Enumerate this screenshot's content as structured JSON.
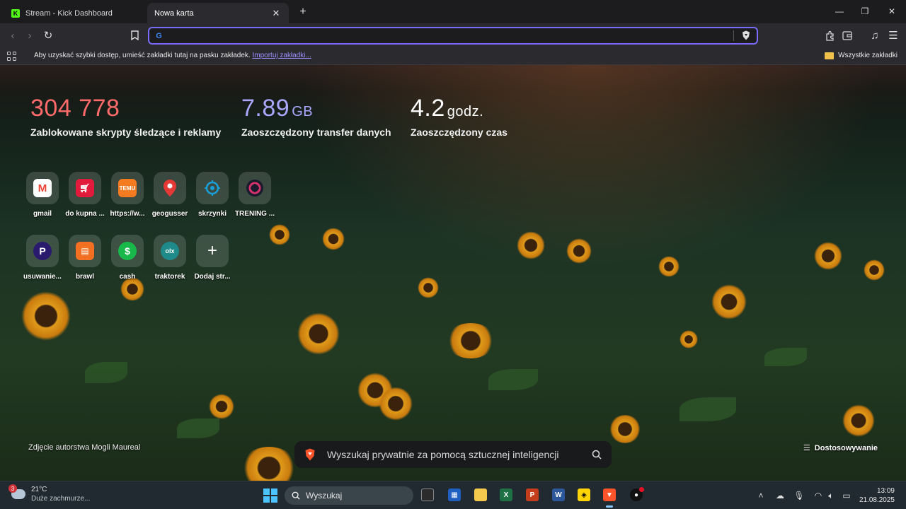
{
  "tabs": [
    {
      "title": "Stream - Kick Dashboard",
      "icon": "kick-icon",
      "active": false
    },
    {
      "title": "Nowa karta",
      "active": true
    }
  ],
  "address_bar": {
    "value": "",
    "search_engine_icon": "google-icon"
  },
  "bookmarks_bar": {
    "message": "Aby uzyskać szybki dostęp, umieść zakładki tutaj na pasku zakładek.",
    "import_link": "Importuj zakładki...",
    "all_bookmarks": "Wszystkie zakładki"
  },
  "stats": [
    {
      "value": "304 778",
      "unit": "",
      "label": "Zablokowane skrypty śledzące i reklamy",
      "color": "#ff6b6b"
    },
    {
      "value": "7.89",
      "unit": "GB",
      "label": "Zaoszczędzony transfer danych",
      "color": "#a9a7ff"
    },
    {
      "value": "4.2",
      "unit": "godz.",
      "label": "Zaoszczędzony czas",
      "color": "#ffffff"
    }
  ],
  "top_sites": [
    {
      "label": "gmail",
      "icon": "gmail-icon",
      "color": "#ea4335"
    },
    {
      "label": "do kupna ...",
      "icon": "cart-icon",
      "color": "#e21b3c"
    },
    {
      "label": "https://w...",
      "icon": "temu-icon",
      "color": "#f47b20"
    },
    {
      "label": "geogusser",
      "icon": "map-pin-icon",
      "color": "#e53935"
    },
    {
      "label": "skrzynki",
      "icon": "target-icon",
      "color": "#1aa0d8"
    },
    {
      "label": "TRENING ...",
      "icon": "trening-icon",
      "color": "#1b1b2e"
    },
    {
      "label": "usuwanie...",
      "icon": "p-icon",
      "color": "#2a1a6e"
    },
    {
      "label": "brawl",
      "icon": "brawl-icon",
      "color": "#f36f21"
    },
    {
      "label": "cash",
      "icon": "cash-icon",
      "color": "#19b84a"
    },
    {
      "label": "traktorek",
      "icon": "olx-icon",
      "color": "#1e8a8a"
    },
    {
      "label": "Dodaj str...",
      "icon": "plus-icon",
      "color": ""
    }
  ],
  "photo_credit": "Zdjęcie autorstwa Mogli Maureal",
  "ai_search_placeholder": "Wyszukaj prywatnie za pomocą sztucznej inteligencji",
  "customize_label": "Dostosowywanie",
  "taskbar": {
    "weather_temp": "21°C",
    "weather_desc": "Duże zachmurze...",
    "weather_badge": "3",
    "search_placeholder": "Wyszukaj",
    "time": "13:09",
    "date": "21.08.2025"
  }
}
